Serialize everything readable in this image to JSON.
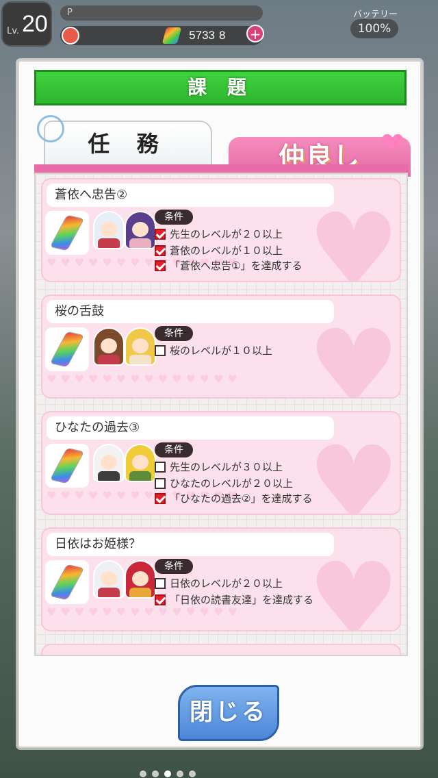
{
  "status_bar": {
    "level_prefix": "Lv.",
    "level": "20",
    "player_bar_label": "P",
    "gold": "5733",
    "crystals": "8",
    "plus_label": "+",
    "battery_label": "バッテリー",
    "battery_value": "100%"
  },
  "dialog": {
    "title": "課 題",
    "tab_mission": "任 務",
    "tab_friendship": "仲良し",
    "close_label": "閉じる",
    "condition_label": "条件"
  },
  "quests": [
    {
      "title": "蒼依へ忠告②",
      "conditions": [
        {
          "text": "先生のレベルが２０以上",
          "checked": true
        },
        {
          "text": "蒼依のレベルが１０以上",
          "checked": true
        },
        {
          "text": "「蒼依へ忠告①」を達成する",
          "checked": true
        }
      ]
    },
    {
      "title": "桜の舌鼓",
      "conditions": [
        {
          "text": "桜のレベルが１０以上",
          "checked": false
        }
      ]
    },
    {
      "title": "ひなたの過去③",
      "conditions": [
        {
          "text": "先生のレベルが３０以上",
          "checked": false
        },
        {
          "text": "ひなたのレベルが２０以上",
          "checked": false
        },
        {
          "text": "「ひなたの過去②」を達成する",
          "checked": true
        }
      ]
    },
    {
      "title": "日依はお姫様？",
      "conditions": [
        {
          "text": "日依のレベルが２０以上",
          "checked": false
        },
        {
          "text": "「日依の読書友達」を達成する",
          "checked": true
        }
      ]
    }
  ],
  "colors": {
    "title_green": "#2eb52e",
    "tab_pink": "#e86aa6",
    "check_red": "#e3202a",
    "close_blue": "#4d86d8"
  }
}
